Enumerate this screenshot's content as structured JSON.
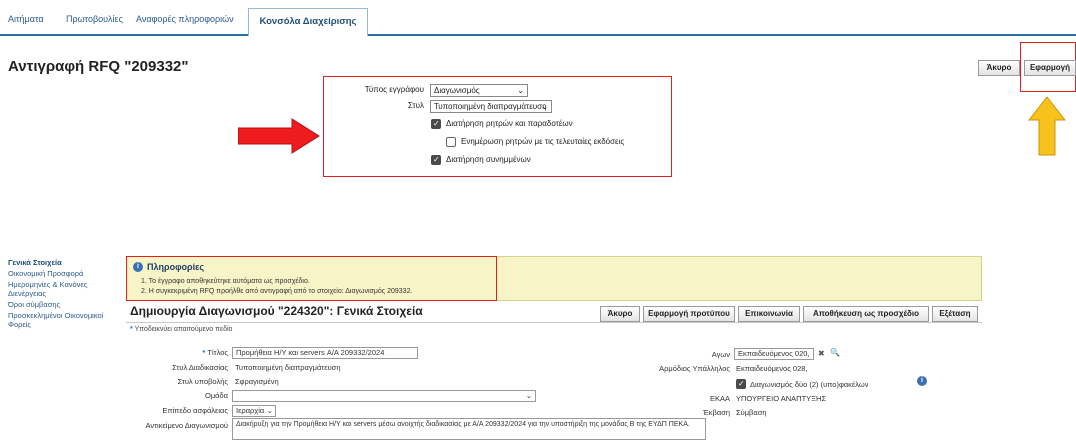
{
  "tabs": {
    "items": [
      "Αιτήματα",
      "Πρωτοβουλίες",
      "Αναφορές πληροφοριών"
    ],
    "active": "Κονσόλα Διαχείρισης"
  },
  "page_title": "Αντιγραφή RFQ \"209332\"",
  "top_buttons": {
    "cancel": "Άκυρο",
    "apply": "Εφαρμογή"
  },
  "copy_options": {
    "doc_type_label": "Τύπος εγγράφου",
    "doc_type_value": "Διαγωνισμός",
    "style_label": "Στυλ",
    "style_value": "Τυποποιημένη διαπραγμάτευση",
    "keep_terms": "Διατήρηση ρητρών και παραδοτέων",
    "update_terms": "Ενημέρωση ρητρών με τις τελευταίες εκδόσεις",
    "keep_attachments": "Διατήρηση συνημμένων"
  },
  "side_nav": [
    "Γενικά Στοιχεία",
    "Οικονομική Προσφορά",
    "Ημερομηνίες & Κανόνες Διενέργειας",
    "Όροι σύμβασης",
    "Προσκεκλημένοι Οικονομικοί Φορείς"
  ],
  "info": {
    "title": "Πληροφορίες",
    "line1": "1. Το έγγραφο αποθηκεύτηκε αυτόματα ως προσχέδιο.",
    "line2": "2. Η συγκεκριμένη RFQ προήλθε από αντιγραφή από το στοιχείο: Διαγωνισμός 209332."
  },
  "detail": {
    "title": "Δημιουργία Διαγωνισμού \"224320\": Γενικά Στοιχεία",
    "required_note": "Υποδεικνύει απαιτούμενο πεδίο",
    "buttons": {
      "cancel": "Άκυρο",
      "apply_template": "Εφαρμογή προτύπου",
      "communication": "Επικοινωνία",
      "save_draft": "Αποθήκευση ως προσχέδιο",
      "review": "Εξέταση"
    },
    "fields": {
      "title_label": "Τίτλος",
      "title_value": "Προμήθεια Η/Υ και servers Α/Α 209332/2024",
      "process_style_label": "Στυλ Διαδικασίας",
      "process_style_value": "Τυποποιημένη διαπραγμάτευση",
      "submission_style_label": "Στυλ υποβολής",
      "submission_style_value": "Σφραγισμένη",
      "group_label": "Ομάδα",
      "group_value": "",
      "security_label": "Επίπεδο ασφάλειας",
      "security_value": "Ιεραρχία",
      "subject_label": "Αντικείμενο Διαγωνισμού",
      "subject_value": "Διακήρυξη για την Προμήθεια Η/Υ και servers μέσω ανοιχτής διαδικασίας με Α/Α 209332/2024 για την υποστήριξη της μονάδας Β της ΕΥΔΠ ΠΕΚΑ.",
      "buyer_label": "Αγων",
      "buyer_value": "Εκπαιδευόμενος 020,",
      "responsible_label": "Αρμόδιος Υπάλληλος",
      "responsible_value": "Εκπαιδευόμενος 028,",
      "envelopes_label": "Διαγωνισμός δύο (2) (υπο)φακέλων",
      "ekaa_label": "ΕΚΑΑ",
      "ekaa_value": "ΥΠΟΥΡΓΕΙΟ ΑΝΑΠΤΥΞΗΣ",
      "outcome_label": "Έκβαση",
      "outcome_value": "Σύμβαση"
    }
  }
}
